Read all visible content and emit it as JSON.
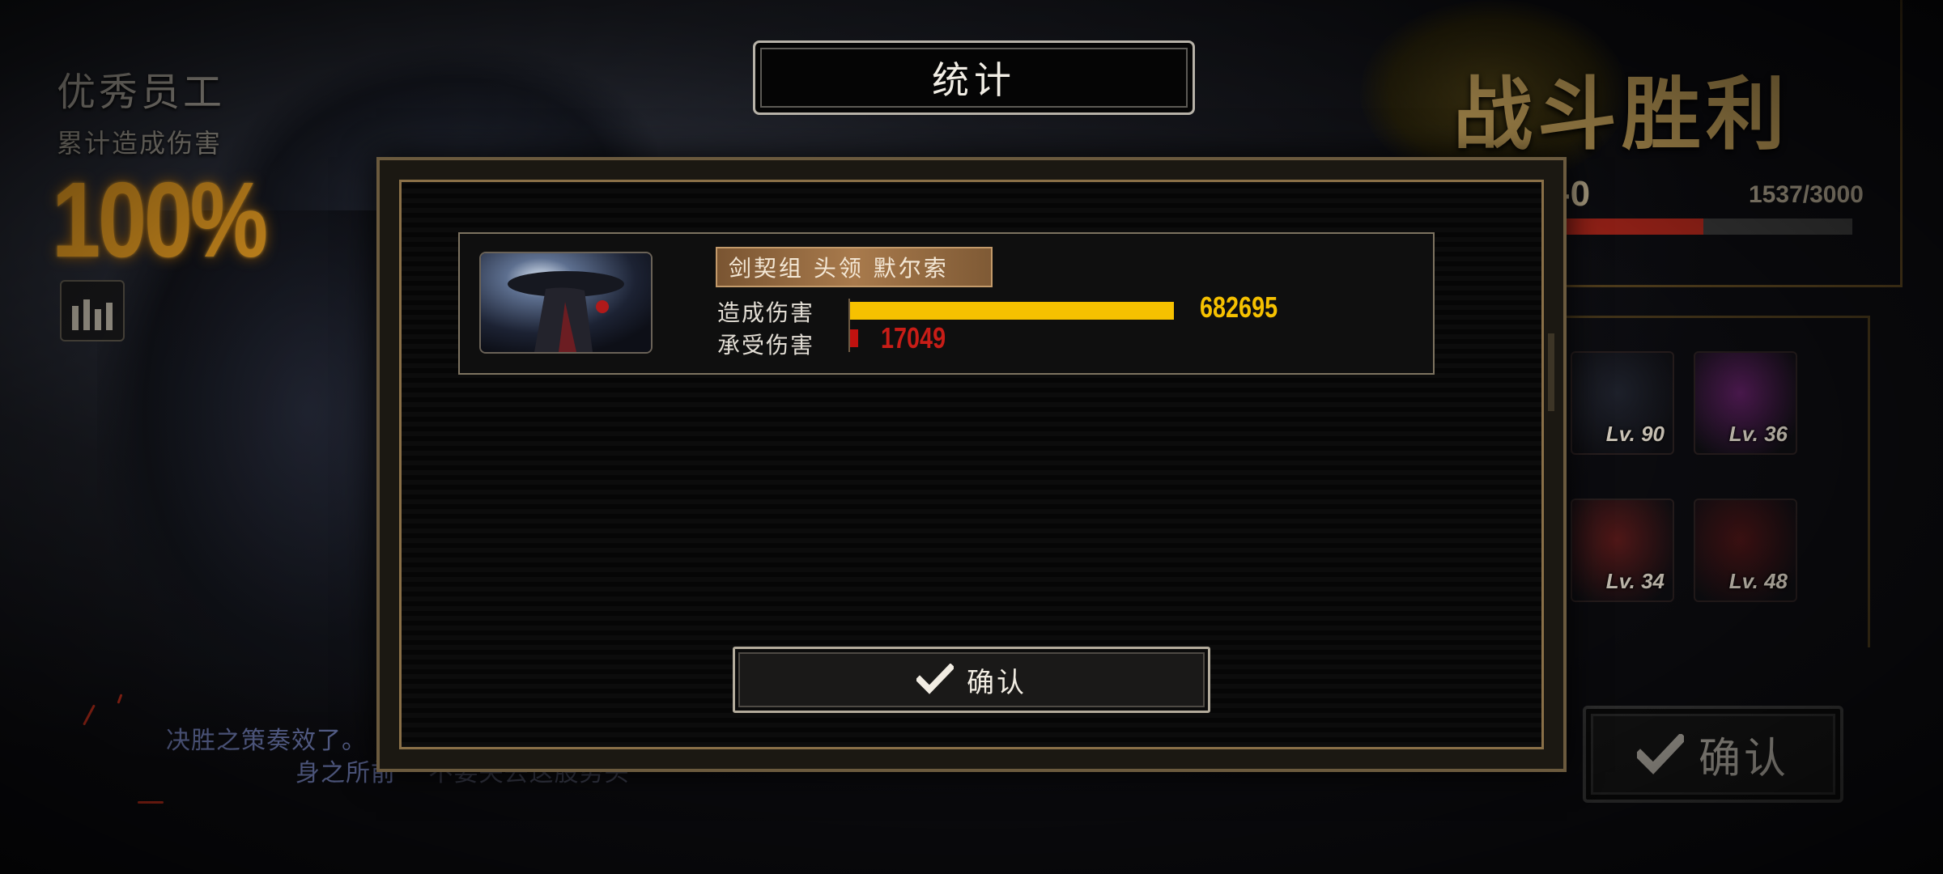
{
  "title": "统计",
  "mvp": {
    "heading": "优秀员工",
    "subheading": "累计造成伤害",
    "percent": "100%",
    "stats_icon": "bar-chart-icon"
  },
  "dialogue": {
    "line1": "决胜之策奏效了。",
    "line1_faded": "[",
    "line2": "身之所前",
    "line2_faded": "不要失去这股势头"
  },
  "victory": {
    "title": "战斗胜利",
    "stage_partial": "-0",
    "exp": "1537/3000",
    "exp_fraction": 0.512,
    "confirm_label": "确认"
  },
  "team": [
    {
      "level": "Lv. 90",
      "color": "#20232e"
    },
    {
      "level": "Lv. 36",
      "color": "#5a1e5e"
    },
    {
      "level": "Lv. 34",
      "color": "#5a1a1a"
    },
    {
      "level": "Lv. 48",
      "color": "#4a1416"
    }
  ],
  "stats": {
    "character_name": "剑契组 头领 默尔索",
    "rows": [
      {
        "label": "造成伤害",
        "value": 682695,
        "display": "682695",
        "color": "#f6c100",
        "value_color": "#f6c100"
      },
      {
        "label": "承受伤害",
        "value": 17049,
        "display": "17049",
        "color": "#c0120f",
        "value_color": "#c81d17"
      }
    ],
    "bar_max": 682695
  },
  "confirm": {
    "label": "确认",
    "icon": "checkmark-icon"
  },
  "colors": {
    "accent_gold": "#c9a55c",
    "damage_dealt": "#f6c100",
    "damage_taken": "#c0120f",
    "mvp_orange": "#f2a423"
  }
}
